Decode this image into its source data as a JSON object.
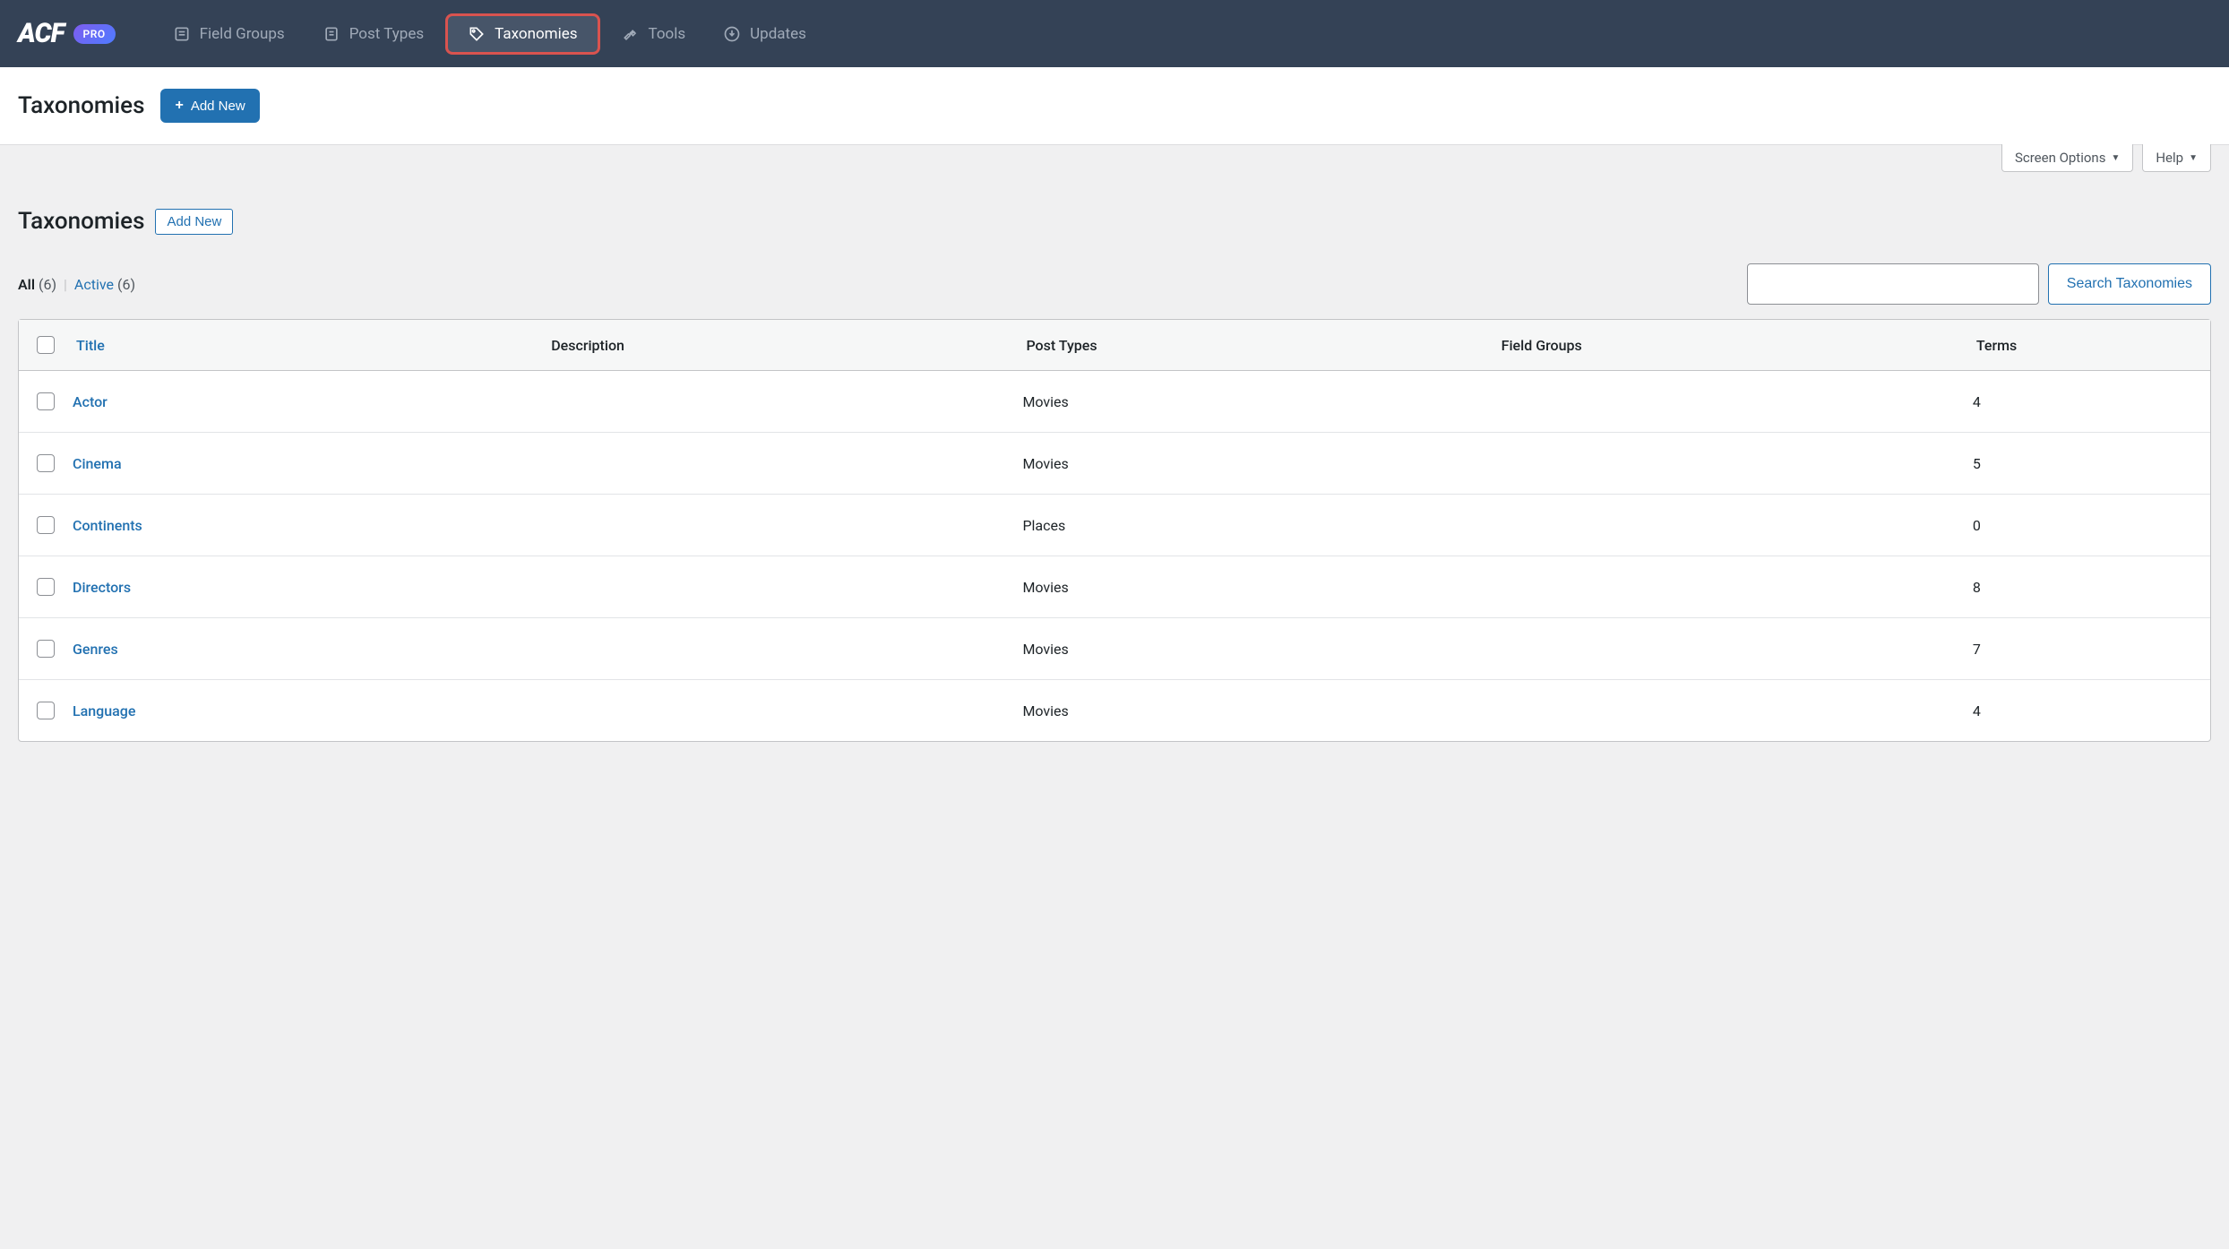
{
  "brand": {
    "logo": "ACF",
    "badge": "PRO"
  },
  "nav": {
    "field_groups": "Field Groups",
    "post_types": "Post Types",
    "taxonomies": "Taxonomies",
    "tools": "Tools",
    "updates": "Updates"
  },
  "header": {
    "title": "Taxonomies",
    "add_new": "Add New"
  },
  "options": {
    "screen_options": "Screen Options",
    "help": "Help"
  },
  "section": {
    "title": "Taxonomies",
    "add_new": "Add New"
  },
  "filters": {
    "all_label": "All",
    "all_count": "(6)",
    "active_label": "Active",
    "active_count": "(6)"
  },
  "search": {
    "button": "Search Taxonomies",
    "placeholder": ""
  },
  "table": {
    "headers": {
      "title": "Title",
      "description": "Description",
      "post_types": "Post Types",
      "field_groups": "Field Groups",
      "terms": "Terms"
    },
    "rows": [
      {
        "title": "Actor",
        "description": "",
        "post_types": "Movies",
        "field_groups": "",
        "terms": "4"
      },
      {
        "title": "Cinema",
        "description": "",
        "post_types": "Movies",
        "field_groups": "",
        "terms": "5"
      },
      {
        "title": "Continents",
        "description": "",
        "post_types": "Places",
        "field_groups": "",
        "terms": "0"
      },
      {
        "title": "Directors",
        "description": "",
        "post_types": "Movies",
        "field_groups": "",
        "terms": "8"
      },
      {
        "title": "Genres",
        "description": "",
        "post_types": "Movies",
        "field_groups": "",
        "terms": "7"
      },
      {
        "title": "Language",
        "description": "",
        "post_types": "Movies",
        "field_groups": "",
        "terms": "4"
      }
    ]
  }
}
